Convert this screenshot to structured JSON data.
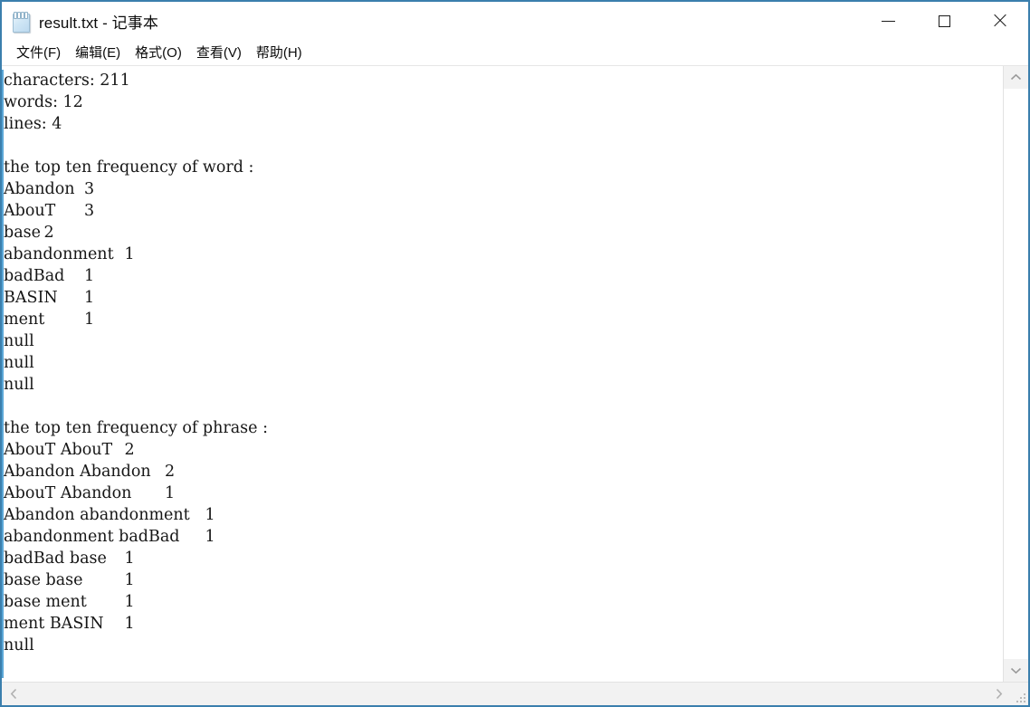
{
  "window": {
    "title": "result.txt - 记事本",
    "file_name": "result.txt",
    "app_name": "记事本",
    "icon": "notepad-icon",
    "border_color": "#3b7fad",
    "titlebar_bg": "#ffffff"
  },
  "window_controls": {
    "minimize": "minimize-icon",
    "maximize": "maximize-icon",
    "close": "close-icon"
  },
  "menu": {
    "items": [
      {
        "label": "文件(F)"
      },
      {
        "label": "编辑(E)"
      },
      {
        "label": "格式(O)"
      },
      {
        "label": "查看(V)"
      },
      {
        "label": "帮助(H)"
      }
    ]
  },
  "editor": {
    "text": "characters: 211\nwords: 12\nlines: 4\n\nthe top ten frequency of word :\nAbandon\t3\nAbouT\t3\nbase\t2\nabandonment\t1\nbadBad\t1\nBASIN\t1\nment\t1\nnull\nnull\nnull\n\nthe top ten frequency of phrase :\nAbouT AbouT\t2\nAbandon Abandon\t2\nAbouT Abandon\t1\nAbandon abandonment\t1\nabandonment badBad\t1\nbadBad base\t1\nbase base\t1\nbase ment\t1\nment BASIN\t1\nnull",
    "text_color": "#161616",
    "caret_color": "#5aa6d6",
    "stats": {
      "characters": 211,
      "words": 12,
      "lines": 4
    },
    "word_frequency_header": "the top ten frequency of word :",
    "word_frequency": [
      {
        "word": "Abandon",
        "count": 3
      },
      {
        "word": "AbouT",
        "count": 3
      },
      {
        "word": "base",
        "count": 2
      },
      {
        "word": "abandonment",
        "count": 1
      },
      {
        "word": "badBad",
        "count": 1
      },
      {
        "word": "BASIN",
        "count": 1
      },
      {
        "word": "ment",
        "count": 1
      },
      {
        "word": "null",
        "count": null
      },
      {
        "word": "null",
        "count": null
      },
      {
        "word": "null",
        "count": null
      }
    ],
    "phrase_frequency_header": "the top ten frequency of phrase :",
    "phrase_frequency": [
      {
        "phrase": "AbouT AbouT",
        "count": 2
      },
      {
        "phrase": "Abandon Abandon",
        "count": 2
      },
      {
        "phrase": "AbouT Abandon",
        "count": 1
      },
      {
        "phrase": "Abandon abandonment",
        "count": 1
      },
      {
        "phrase": "abandonment badBad",
        "count": 1
      },
      {
        "phrase": "badBad base",
        "count": 1
      },
      {
        "phrase": "base base",
        "count": 1
      },
      {
        "phrase": "base ment",
        "count": 1
      },
      {
        "phrase": "ment BASIN",
        "count": 1
      },
      {
        "phrase": "null",
        "count": null
      }
    ]
  },
  "scrollbars": {
    "vertical": {
      "up_icon": "chevron-up-icon",
      "down_icon": "chevron-down-icon"
    },
    "horizontal": {
      "left_icon": "chevron-left-icon",
      "right_icon": "chevron-right-icon"
    },
    "resize_grip": "resize-grip-icon"
  }
}
